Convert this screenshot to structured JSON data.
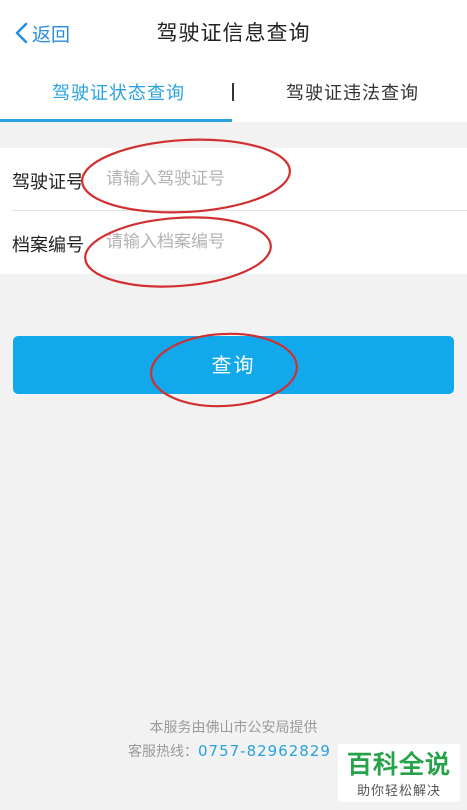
{
  "header": {
    "back_label": "返回",
    "title": "驾驶证信息查询"
  },
  "tabs": [
    {
      "label": "驾驶证状态查询",
      "active": true
    },
    {
      "label": "驾驶证违法查询",
      "active": false
    }
  ],
  "form": {
    "license_label": "驾驶证号",
    "license_placeholder": "请输入驾驶证号",
    "license_value": "",
    "archive_label": "档案编号",
    "archive_placeholder": "请输入档案编号",
    "archive_value": ""
  },
  "query_button_label": "查询",
  "footer": {
    "provider": "本服务由佛山市公安局提供",
    "hotline_label": "客服热线：",
    "hotline_number": "0757-82962829"
  },
  "watermark": {
    "title": "百科全说",
    "subtitle": "助你轻松解决"
  },
  "colors": {
    "accent": "#29a1df",
    "button": "#12a9ec",
    "annotation": "#d03030",
    "watermark_green": "#27a24a",
    "background": "#f2f2f2"
  },
  "icons": {
    "back": "chevron-left-icon"
  }
}
